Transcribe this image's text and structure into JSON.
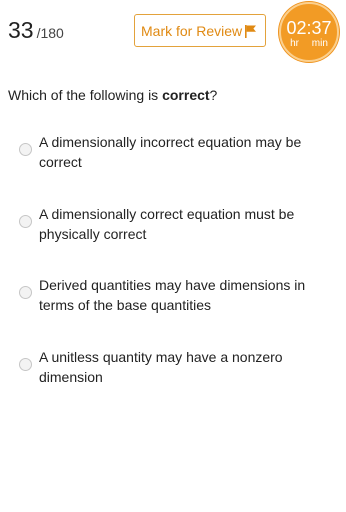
{
  "header": {
    "question_number": "33",
    "question_total": "/180",
    "mark_for_review_label": "Mark for Review",
    "flag_icon": "flag-icon",
    "timer": {
      "time": "02:37",
      "hours_label": "hr",
      "minutes_label": "min"
    }
  },
  "question": {
    "prefix": "Which of the following is ",
    "emphasis": "correct",
    "suffix": "?"
  },
  "options": [
    "A dimensionally incorrect equation may be correct",
    "A dimensionally correct equation must be physically correct",
    "Derived quantities may have dimensions in terms of the base quantities",
    "A unitless quantity may have a nonzero dimension"
  ],
  "colors": {
    "accent": "#f29b25",
    "accent_text": "#e08a13",
    "text": "#222222"
  }
}
